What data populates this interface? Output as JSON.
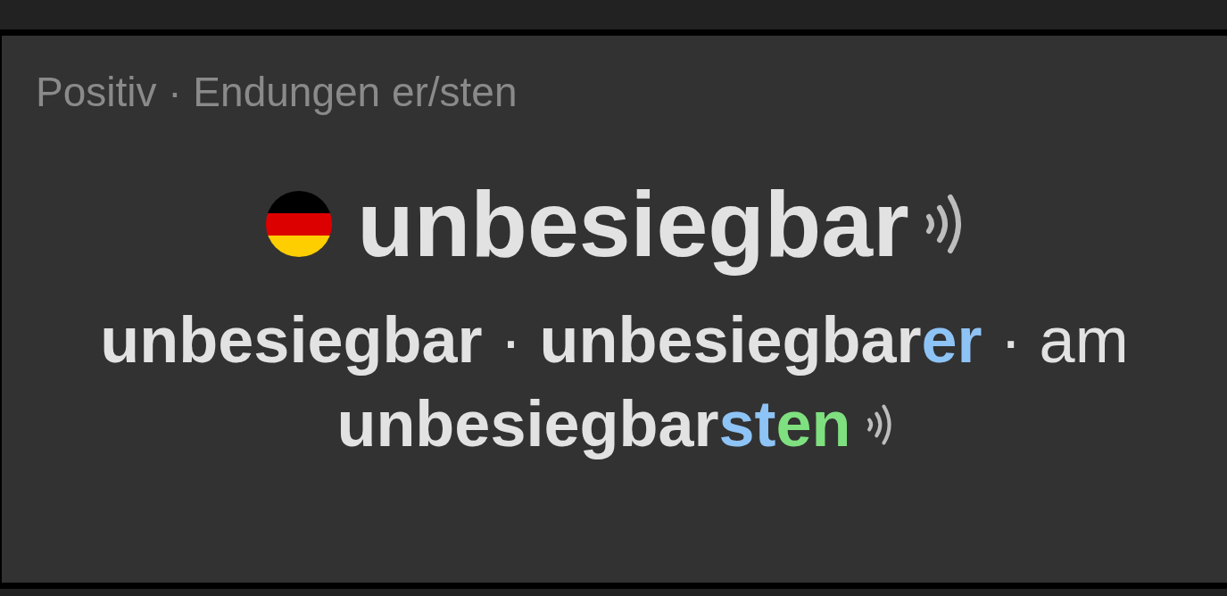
{
  "card": {
    "subtitle": "Positiv · Endungen er/sten",
    "headword": "unbesiegbar",
    "forms_lines": [
      [
        {
          "kind": "stem",
          "text": "unbesiegbar"
        },
        {
          "kind": "separator",
          "text": " · "
        },
        {
          "kind": "stem",
          "text": "unbesiegbar"
        },
        {
          "kind": "ending",
          "text": "er",
          "color": "#8ec3f5"
        },
        {
          "kind": "separator",
          "text": " · am"
        }
      ],
      [
        {
          "kind": "stem",
          "text": "unbesiegbar"
        },
        {
          "kind": "ending",
          "text": "st",
          "color": "#8ec3f5"
        },
        {
          "kind": "ending",
          "text": "en",
          "color": "#7fe07f"
        }
      ]
    ]
  }
}
